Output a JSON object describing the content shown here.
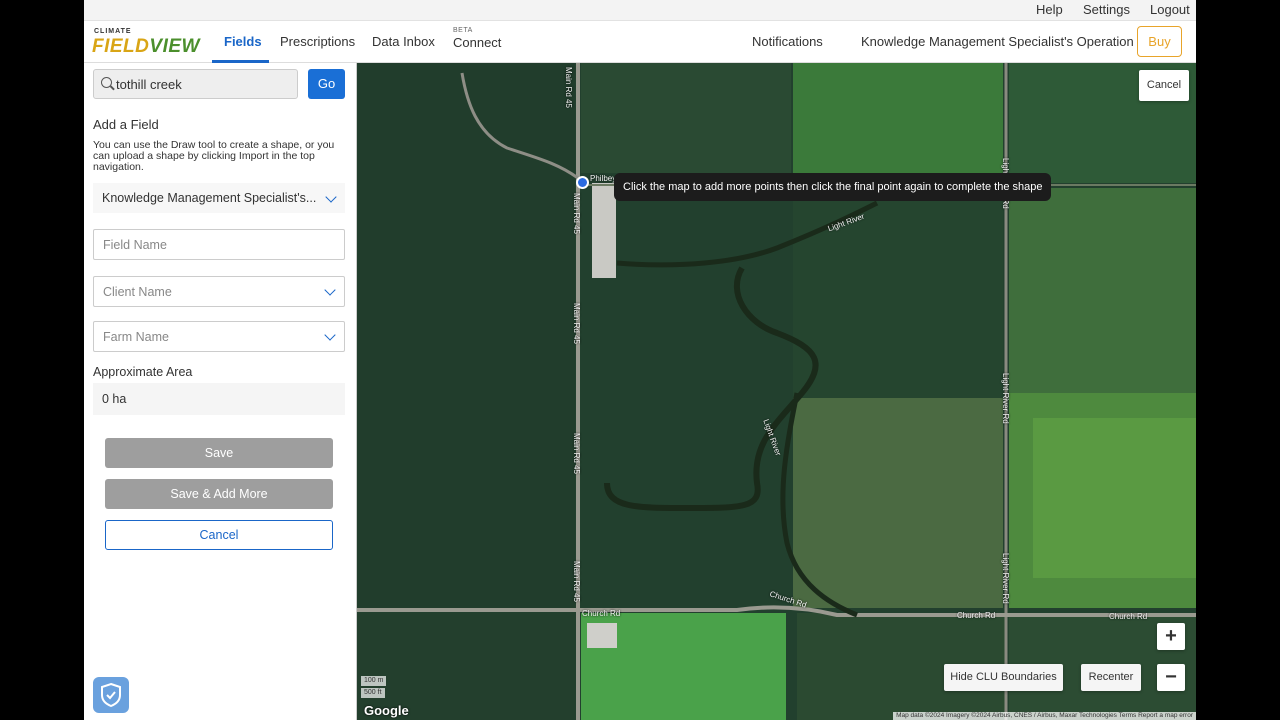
{
  "util_bar": {
    "help": "Help",
    "settings": "Settings",
    "logout": "Logout"
  },
  "brand": {
    "small": "CLIMATE",
    "main_a": "FIELD",
    "main_b": "VIEW"
  },
  "nav": {
    "items": [
      "Fields",
      "Prescriptions",
      "Data Inbox",
      "Connect"
    ],
    "active": "Fields",
    "beta_tag": "BETA",
    "notifications": "Notifications",
    "operation": "Knowledge Management Specialist's Operation",
    "buy": "Buy"
  },
  "sidebar": {
    "search_value": "tothill creek",
    "go": "Go",
    "section_title": "Add a Field",
    "help_text": "You can use the Draw tool to create a shape, or you can upload a shape by clicking Import in the top navigation.",
    "operation_select": "Knowledge Management Specialist's...",
    "field_name_placeholder": "Field Name",
    "client_name_placeholder": "Client Name",
    "farm_name_placeholder": "Farm Name",
    "area_label": "Approximate Area",
    "area_value": "0 ha",
    "save": "Save",
    "save_add_more": "Save & Add More",
    "cancel": "Cancel"
  },
  "map": {
    "cancel": "Cancel",
    "tooltip": "Click the map to add more points then click the final point again to complete the shape",
    "road_labels": [
      "Main Rd 45",
      "Main Rd 45",
      "Main Rd 45",
      "Main Rd 45",
      "Main Rd 45",
      "Church Rd",
      "Church Rd",
      "Church Rd",
      "Church Rd",
      "Light River",
      "Light River",
      "Light River Rd",
      "Light River Rd",
      "Light River Rd",
      "Philbey"
    ],
    "hide_clu": "Hide CLU Boundaries",
    "recenter": "Recenter",
    "zoom_in": "+",
    "zoom_out": "−",
    "scale_m": "100 m",
    "scale_ft": "500 ft",
    "google": "Google",
    "attribution": "Map data ©2024 Imagery ©2024 Airbus, CNES / Airbus, Maxar Technologies   Terms   Report a map error"
  },
  "colors": {
    "accent_blue": "#1a66c8",
    "buy_orange": "#e8a42a",
    "logo_gold": "#d9a516",
    "logo_green": "#4b8f2c"
  }
}
